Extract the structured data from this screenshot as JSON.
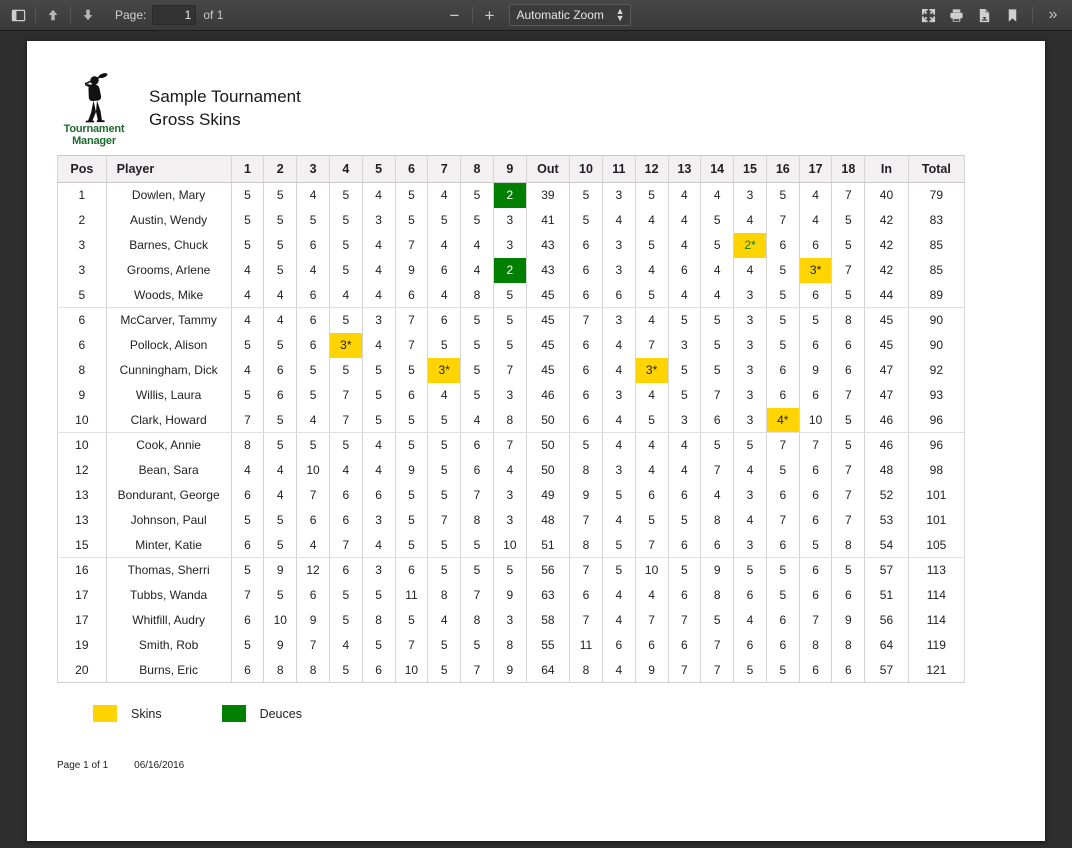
{
  "toolbar": {
    "sidebar_toggle": "sidebar-toggle",
    "page_label": "Page:",
    "page_number": "1",
    "page_total": "of 1",
    "zoom_out": "−",
    "zoom_in": "+",
    "scale_value": "Automatic Zoom",
    "presentation": "presentation-mode",
    "print": "print",
    "download": "download",
    "bookmark": "bookmark",
    "more": "»"
  },
  "report": {
    "logo_line1": "Tournament",
    "logo_line2": "Manager",
    "title_line1": "Sample Tournament",
    "title_line2": "Gross Skins"
  },
  "table": {
    "headers": [
      "Pos",
      "Player",
      "1",
      "2",
      "3",
      "4",
      "5",
      "6",
      "7",
      "8",
      "9",
      "Out",
      "10",
      "11",
      "12",
      "13",
      "14",
      "15",
      "16",
      "17",
      "18",
      "In",
      "Total"
    ],
    "rows": [
      {
        "pos": "1",
        "player": "Dowlen, Mary",
        "scores": [
          "5",
          "5",
          "4",
          "5",
          "4",
          "5",
          "4",
          "5",
          "2"
        ],
        "out": "39",
        "scores_in": [
          "5",
          "3",
          "5",
          "4",
          "4",
          "3",
          "5",
          "4",
          "7"
        ],
        "in": "40",
        "total": "79",
        "hl": {
          "9": "deuce"
        }
      },
      {
        "pos": "2",
        "player": "Austin, Wendy",
        "scores": [
          "5",
          "5",
          "5",
          "5",
          "3",
          "5",
          "5",
          "5",
          "3"
        ],
        "out": "41",
        "scores_in": [
          "5",
          "4",
          "4",
          "4",
          "5",
          "4",
          "7",
          "4",
          "5"
        ],
        "in": "42",
        "total": "83",
        "hl": {}
      },
      {
        "pos": "3",
        "player": "Barnes, Chuck",
        "scores": [
          "5",
          "5",
          "6",
          "5",
          "4",
          "7",
          "4",
          "4",
          "3"
        ],
        "out": "43",
        "scores_in": [
          "6",
          "3",
          "5",
          "4",
          "5",
          "2*",
          "6",
          "6",
          "5"
        ],
        "in": "42",
        "total": "85",
        "hl": {
          "15": "skin-deuce"
        }
      },
      {
        "pos": "3",
        "player": "Grooms, Arlene",
        "scores": [
          "4",
          "5",
          "4",
          "5",
          "4",
          "9",
          "6",
          "4",
          "2"
        ],
        "out": "43",
        "scores_in": [
          "6",
          "3",
          "4",
          "6",
          "4",
          "4",
          "5",
          "3*",
          "7"
        ],
        "in": "42",
        "total": "85",
        "hl": {
          "9": "deuce",
          "17": "skin"
        }
      },
      {
        "pos": "5",
        "player": "Woods, Mike",
        "scores": [
          "4",
          "4",
          "6",
          "4",
          "4",
          "6",
          "4",
          "8",
          "5"
        ],
        "out": "45",
        "scores_in": [
          "6",
          "6",
          "5",
          "4",
          "4",
          "3",
          "5",
          "6",
          "5"
        ],
        "in": "44",
        "total": "89",
        "hl": {},
        "group_end": true
      },
      {
        "pos": "6",
        "player": "McCarver, Tammy",
        "scores": [
          "4",
          "4",
          "6",
          "5",
          "3",
          "7",
          "6",
          "5",
          "5"
        ],
        "out": "45",
        "scores_in": [
          "7",
          "3",
          "4",
          "5",
          "5",
          "3",
          "5",
          "5",
          "8"
        ],
        "in": "45",
        "total": "90",
        "hl": {}
      },
      {
        "pos": "6",
        "player": "Pollock, Alison",
        "scores": [
          "5",
          "5",
          "6",
          "3*",
          "4",
          "7",
          "5",
          "5",
          "5"
        ],
        "out": "45",
        "scores_in": [
          "6",
          "4",
          "7",
          "3",
          "5",
          "3",
          "5",
          "6",
          "6"
        ],
        "in": "45",
        "total": "90",
        "hl": {
          "4": "skin"
        }
      },
      {
        "pos": "8",
        "player": "Cunningham, Dick",
        "scores": [
          "4",
          "6",
          "5",
          "5",
          "5",
          "5",
          "3*",
          "5",
          "7"
        ],
        "out": "45",
        "scores_in": [
          "6",
          "4",
          "3*",
          "5",
          "5",
          "3",
          "6",
          "9",
          "6"
        ],
        "in": "47",
        "total": "92",
        "hl": {
          "7": "skin",
          "12": "skin"
        }
      },
      {
        "pos": "9",
        "player": "Willis, Laura",
        "scores": [
          "5",
          "6",
          "5",
          "7",
          "5",
          "6",
          "4",
          "5",
          "3"
        ],
        "out": "46",
        "scores_in": [
          "6",
          "3",
          "4",
          "5",
          "7",
          "3",
          "6",
          "6",
          "7"
        ],
        "in": "47",
        "total": "93",
        "hl": {}
      },
      {
        "pos": "10",
        "player": "Clark, Howard",
        "scores": [
          "7",
          "5",
          "4",
          "7",
          "5",
          "5",
          "5",
          "4",
          "8"
        ],
        "out": "50",
        "scores_in": [
          "6",
          "4",
          "5",
          "3",
          "6",
          "3",
          "4*",
          "10",
          "5"
        ],
        "in": "46",
        "total": "96",
        "hl": {
          "16": "skin"
        },
        "group_end": true
      },
      {
        "pos": "10",
        "player": "Cook, Annie",
        "scores": [
          "8",
          "5",
          "5",
          "5",
          "4",
          "5",
          "5",
          "6",
          "7"
        ],
        "out": "50",
        "scores_in": [
          "5",
          "4",
          "4",
          "4",
          "5",
          "5",
          "7",
          "7",
          "5"
        ],
        "in": "46",
        "total": "96",
        "hl": {}
      },
      {
        "pos": "12",
        "player": "Bean, Sara",
        "scores": [
          "4",
          "4",
          "10",
          "4",
          "4",
          "9",
          "5",
          "6",
          "4"
        ],
        "out": "50",
        "scores_in": [
          "8",
          "3",
          "4",
          "4",
          "7",
          "4",
          "5",
          "6",
          "7"
        ],
        "in": "48",
        "total": "98",
        "hl": {}
      },
      {
        "pos": "13",
        "player": "Bondurant, George",
        "scores": [
          "6",
          "4",
          "7",
          "6",
          "6",
          "5",
          "5",
          "7",
          "3"
        ],
        "out": "49",
        "scores_in": [
          "9",
          "5",
          "6",
          "6",
          "4",
          "3",
          "6",
          "6",
          "7"
        ],
        "in": "52",
        "total": "101",
        "hl": {}
      },
      {
        "pos": "13",
        "player": "Johnson, Paul",
        "scores": [
          "5",
          "5",
          "6",
          "6",
          "3",
          "5",
          "7",
          "8",
          "3"
        ],
        "out": "48",
        "scores_in": [
          "7",
          "4",
          "5",
          "5",
          "8",
          "4",
          "7",
          "6",
          "7"
        ],
        "in": "53",
        "total": "101",
        "hl": {}
      },
      {
        "pos": "15",
        "player": "Minter, Katie",
        "scores": [
          "6",
          "5",
          "4",
          "7",
          "4",
          "5",
          "5",
          "5",
          "10"
        ],
        "out": "51",
        "scores_in": [
          "8",
          "5",
          "7",
          "6",
          "6",
          "3",
          "6",
          "5",
          "8"
        ],
        "in": "54",
        "total": "105",
        "hl": {},
        "group_end": true
      },
      {
        "pos": "16",
        "player": "Thomas, Sherri",
        "scores": [
          "5",
          "9",
          "12",
          "6",
          "3",
          "6",
          "5",
          "5",
          "5"
        ],
        "out": "56",
        "scores_in": [
          "7",
          "5",
          "10",
          "5",
          "9",
          "5",
          "5",
          "6",
          "5"
        ],
        "in": "57",
        "total": "113",
        "hl": {}
      },
      {
        "pos": "17",
        "player": "Tubbs, Wanda",
        "scores": [
          "7",
          "5",
          "6",
          "5",
          "5",
          "11",
          "8",
          "7",
          "9"
        ],
        "out": "63",
        "scores_in": [
          "6",
          "4",
          "4",
          "6",
          "8",
          "6",
          "5",
          "6",
          "6"
        ],
        "in": "51",
        "total": "114",
        "hl": {}
      },
      {
        "pos": "17",
        "player": "Whitfill, Audry",
        "scores": [
          "6",
          "10",
          "9",
          "5",
          "8",
          "5",
          "4",
          "8",
          "3"
        ],
        "out": "58",
        "scores_in": [
          "7",
          "4",
          "7",
          "7",
          "5",
          "4",
          "6",
          "7",
          "9"
        ],
        "in": "56",
        "total": "114",
        "hl": {}
      },
      {
        "pos": "19",
        "player": "Smith, Rob",
        "scores": [
          "5",
          "9",
          "7",
          "4",
          "5",
          "7",
          "5",
          "5",
          "8"
        ],
        "out": "55",
        "scores_in": [
          "11",
          "6",
          "6",
          "6",
          "7",
          "6",
          "6",
          "8",
          "8"
        ],
        "in": "64",
        "total": "119",
        "hl": {}
      },
      {
        "pos": "20",
        "player": "Burns, Eric",
        "scores": [
          "6",
          "8",
          "8",
          "5",
          "6",
          "10",
          "5",
          "7",
          "9"
        ],
        "out": "64",
        "scores_in": [
          "8",
          "4",
          "9",
          "7",
          "7",
          "5",
          "5",
          "6",
          "6"
        ],
        "in": "57",
        "total": "121",
        "hl": {}
      }
    ]
  },
  "legend": {
    "skins_label": "Skins",
    "deuces_label": "Deuces",
    "skins_color": "#ffd400",
    "deuces_color": "#008000"
  },
  "footer": {
    "page": "Page 1 of 1",
    "date": "06/16/2016"
  }
}
